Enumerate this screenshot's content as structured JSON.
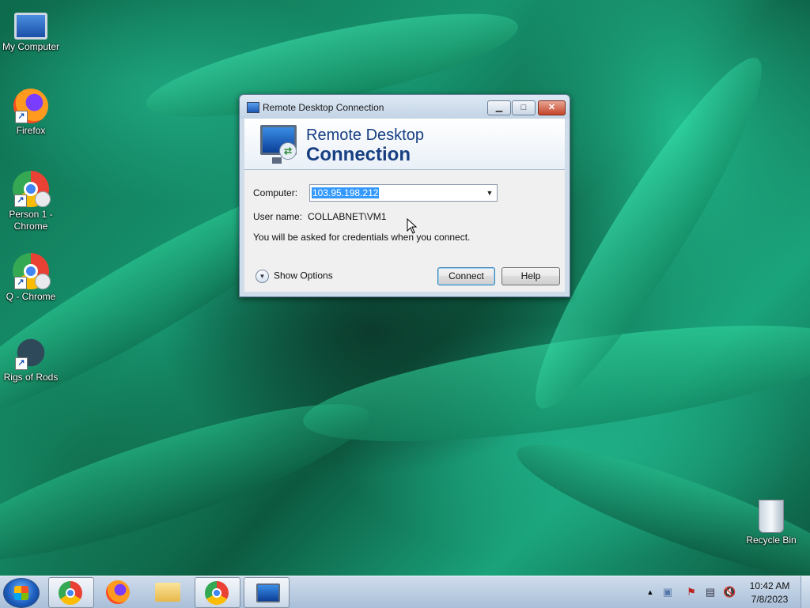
{
  "desktop": {
    "icons": [
      {
        "label": "My Computer",
        "icon": "computer-icon"
      },
      {
        "label": "Firefox",
        "icon": "firefox-icon"
      },
      {
        "label": "Person 1 - Chrome",
        "icon": "chrome-icon"
      },
      {
        "label": "Q - Chrome",
        "icon": "chrome-icon"
      },
      {
        "label": "Rigs of Rods",
        "icon": "rigs-of-rods-icon"
      },
      {
        "label": "Recycle Bin",
        "icon": "recycle-bin-icon"
      }
    ]
  },
  "dialog": {
    "title": "Remote Desktop Connection",
    "banner_line1": "Remote Desktop",
    "banner_line2": "Connection",
    "computer_label": "Computer:",
    "computer_value": "103.95.198.212",
    "username_label": "User name:",
    "username_value": "COLLABNET\\VM1",
    "info_text": "You will be asked for credentials when you connect.",
    "show_options_label": "Show Options",
    "connect_label": "Connect",
    "help_label": "Help",
    "min_glyph": "▁",
    "max_glyph": "□",
    "close_glyph": "✕"
  },
  "taskbar": {
    "items": [
      {
        "icon": "chrome-icon",
        "active": true
      },
      {
        "icon": "firefox-icon",
        "active": false
      },
      {
        "icon": "folder-icon",
        "active": false
      },
      {
        "icon": "chrome-icon",
        "active": true
      },
      {
        "icon": "remote-desktop-icon",
        "active": true
      }
    ],
    "clock_time": "10:42 AM",
    "clock_date": "7/8/2023"
  },
  "colors": {
    "dialog_title_blue": "#173f82",
    "selection_blue": "#3399ff"
  }
}
